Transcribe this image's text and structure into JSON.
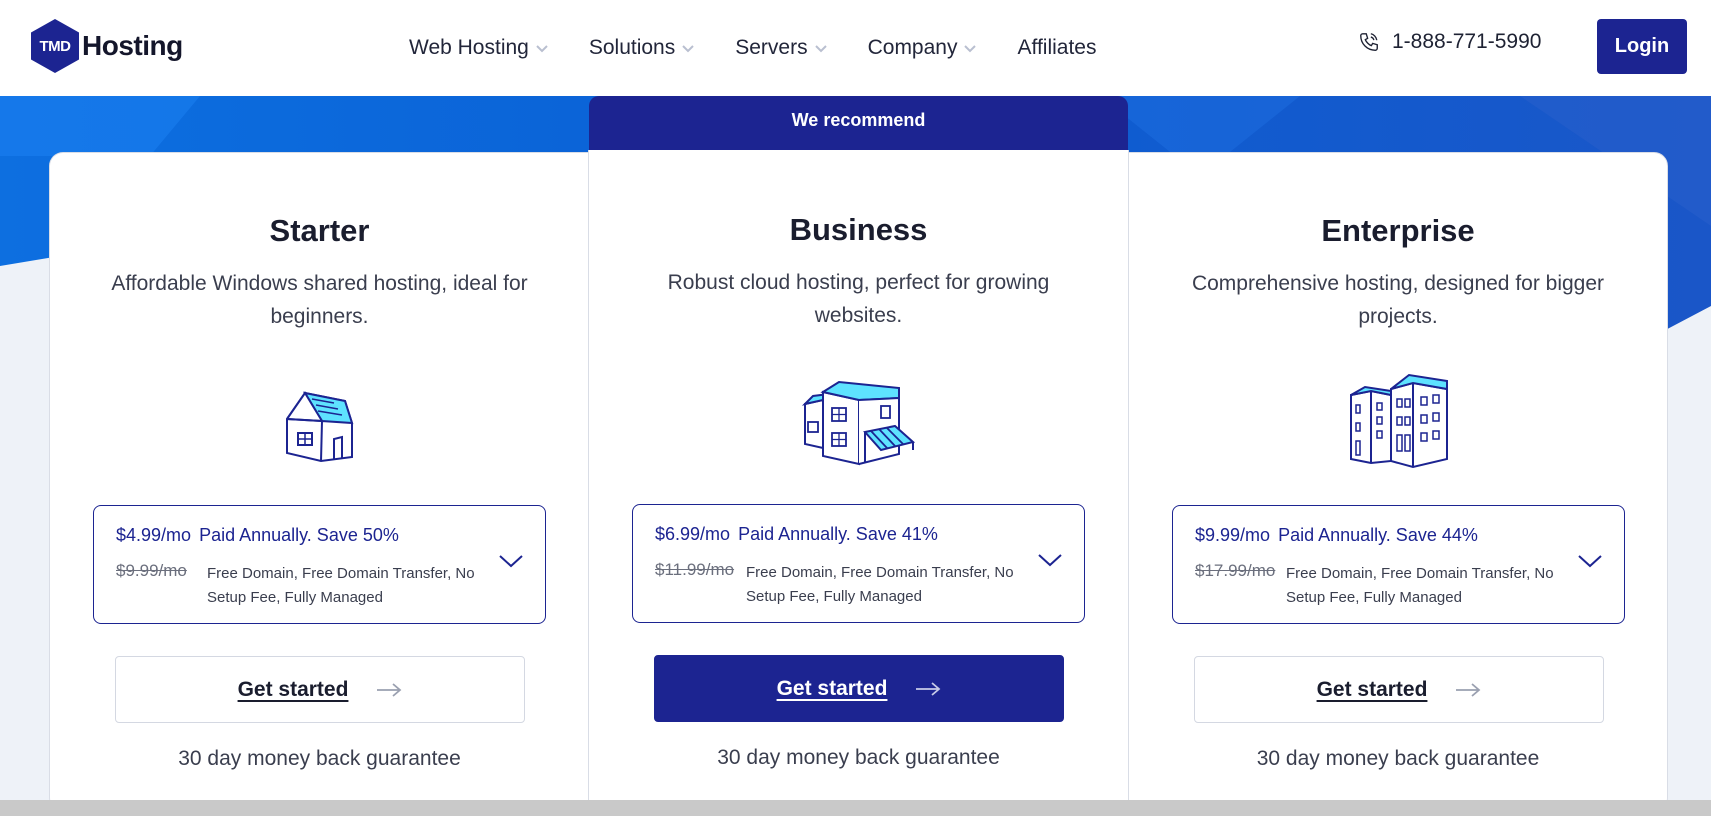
{
  "brand": {
    "logo_badge": "TMD",
    "logo_text": "Hosting"
  },
  "nav": {
    "items": [
      {
        "label": "Web Hosting",
        "has_dropdown": true
      },
      {
        "label": "Solutions",
        "has_dropdown": true
      },
      {
        "label": "Servers",
        "has_dropdown": true
      },
      {
        "label": "Company",
        "has_dropdown": true
      },
      {
        "label": "Affiliates",
        "has_dropdown": false
      }
    ],
    "phone": "1-888-771-5990",
    "login_label": "Login"
  },
  "colors": {
    "brand_navy": "#1c2491",
    "banner_blue": "#0a63d8",
    "accent_cyan": "#5ee2ff"
  },
  "plans": {
    "recommend_label": "We recommend",
    "items": [
      {
        "name": "Starter",
        "description": "Affordable Windows shared hosting, ideal for beginners.",
        "icon": "house-icon",
        "price": "$4.99/mo",
        "billing": "Paid Annually. Save 50%",
        "old_price": "$9.99/mo",
        "features": "Free Domain, Free Domain Transfer, No Setup Fee, Fully Managed",
        "cta": "Get started",
        "guarantee": "30 day money back guarantee"
      },
      {
        "name": "Business",
        "description": "Robust cloud hosting, perfect for growing websites.",
        "icon": "storefront-icon",
        "price": "$6.99/mo",
        "billing": "Paid Annually. Save 41%",
        "old_price": "$11.99/mo",
        "features": "Free Domain, Free Domain Transfer, No Setup Fee, Fully Managed",
        "cta": "Get started",
        "guarantee": "30 day money back guarantee"
      },
      {
        "name": "Enterprise",
        "description": "Comprehensive hosting, designed for bigger projects.",
        "icon": "office-buildings-icon",
        "price": "$9.99/mo",
        "billing": "Paid Annually. Save 44%",
        "old_price": "$17.99/mo",
        "features": "Free Domain, Free Domain Transfer, No Setup Fee, Fully Managed",
        "cta": "Get started",
        "guarantee": "30 day money back guarantee"
      }
    ]
  }
}
